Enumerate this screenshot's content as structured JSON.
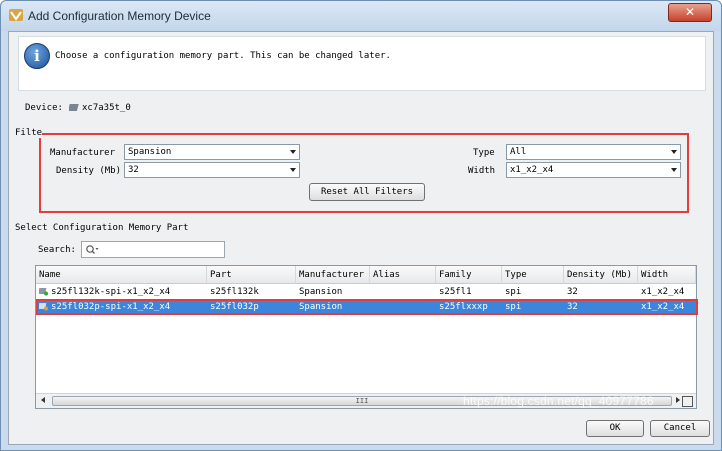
{
  "window": {
    "title": "Add Configuration Memory Device",
    "close_label": "✕"
  },
  "info": {
    "message": "Choose a configuration memory part. This can be changed later."
  },
  "device": {
    "label": "Device:",
    "value": "xc7a35t_0"
  },
  "filter": {
    "legend": "Filte",
    "manufacturer_label": "Manufacturer",
    "manufacturer_value": "Spansion",
    "density_label": "Density (Mb)",
    "density_value": "32",
    "type_label": "Type",
    "type_value": "All",
    "width_label": "Width",
    "width_value": "x1_x2_x4",
    "reset_label": "Reset All Filters"
  },
  "parts": {
    "section_label": "Select Configuration Memory Part",
    "search_label": "Search:",
    "search_placeholder": "",
    "columns": [
      "Name",
      "Part",
      "Manufacturer",
      "Alias",
      "Family",
      "Type",
      "Density (Mb)",
      "Width"
    ],
    "rows": [
      {
        "name": "s25fl132k-spi-x1_x2_x4",
        "part": "s25fl132k",
        "manufacturer": "Spansion",
        "alias": "",
        "family": "s25fl1",
        "type": "spi",
        "density": "32",
        "width": "x1_x2_x4",
        "selected": false
      },
      {
        "name": "s25fl032p-spi-x1_x2_x4",
        "part": "s25fl032p",
        "manufacturer": "Spansion",
        "alias": "",
        "family": "s25flxxxp",
        "type": "spi",
        "density": "32",
        "width": "x1_x2_x4",
        "selected": true
      }
    ],
    "scroll_grip": "III"
  },
  "buttons": {
    "ok": "OK",
    "cancel": "Cancel"
  },
  "watermark": "https://blog.csdn.net/qq_40977786",
  "colors": {
    "highlight_frame": "#e23c3c",
    "selection": "#3b86dc",
    "title_bar": "#c9dbec"
  }
}
